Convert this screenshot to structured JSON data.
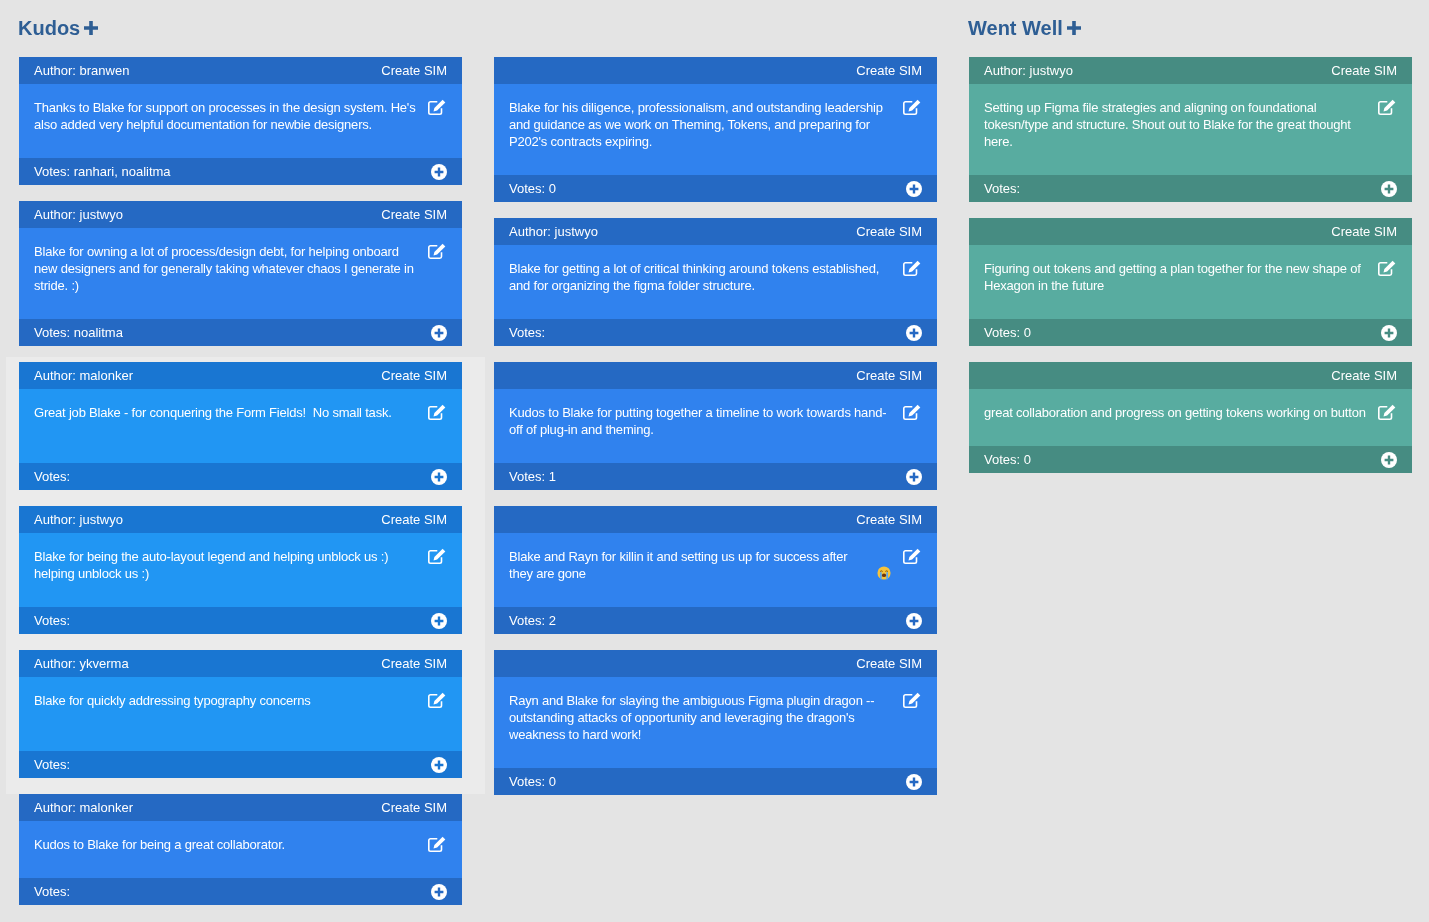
{
  "sections": [
    {
      "title": "Kudos",
      "color": "#2569c3",
      "lanes": [
        {
          "cards": [
            {
              "author": "Author: branwen",
              "action": "Create SIM",
              "text": "Thanks to Blake for support on processes in the design system. He's also added very helpful documentation for newbie designers.",
              "votes": "Votes: ranhari, noalitma",
              "highlighted": false
            },
            {
              "author": "Author: justwyo",
              "action": "Create SIM",
              "text": "Blake for owning a lot of process/design debt, for helping onboard new designers and for generally taking whatever chaos I generate in stride. :)",
              "votes": "Votes: noalitma",
              "highlighted": false
            },
            {
              "author": "Author: malonker",
              "action": "Create SIM",
              "text": "Great job Blake - for conquering the Form Fields!  No small task.",
              "votes": "Votes:",
              "highlighted": true
            },
            {
              "author": "Author: justwyo",
              "action": "Create SIM",
              "text": "Blake for being the auto-layout legend and helping unblock us :)\nhelping unblock us :)",
              "votes": "Votes:",
              "highlighted": true
            },
            {
              "author": "Author: ykverma",
              "action": "Create SIM",
              "text": "Blake for quickly addressing typography concerns",
              "votes": "Votes:",
              "highlighted": true
            },
            {
              "author": "Author: malonker",
              "action": "Create SIM",
              "text": "Kudos to Blake for being a great collaborator.",
              "votes": "Votes:",
              "highlighted": false
            }
          ]
        },
        {
          "cards": [
            {
              "action": "Create SIM",
              "text": "Blake for his diligence, professionalism, and outstanding leadership and guidance as we work on Theming, Tokens, and preparing for P202's contracts expiring.",
              "votes": "Votes: 0",
              "highlighted": false
            },
            {
              "author": "Author: justwyo",
              "action": "Create SIM",
              "text": "Blake for getting a lot of critical thinking around tokens established, and for organizing the figma folder structure.",
              "votes": "Votes:",
              "highlighted": false
            },
            {
              "action": "Create SIM",
              "text": "Kudos to Blake for putting together a timeline to work towards hand-off of plug-in and theming.",
              "votes": "Votes: 1",
              "highlighted": false
            },
            {
              "action": "Create SIM",
              "text": "Blake and Rayn for killin it and setting us up for success after they are gone",
              "reaction_icon": true,
              "votes": "Votes: 2",
              "highlighted": false
            },
            {
              "action": "Create SIM",
              "text": "Rayn and Blake for slaying the ambiguous Figma plugin dragon -- outstanding attacks of opportunity and leveraging the dragon's weakness to hard work!",
              "votes": "Votes: 0",
              "highlighted": false
            }
          ]
        }
      ]
    },
    {
      "title": "Went Well",
      "color": "#468c82",
      "lanes": [
        {
          "cards": [
            {
              "author": "Author: justwyo",
              "action": "Create SIM",
              "text": "Setting up Figma file strategies and aligning on foundational tokesn/type and structure. Shout out to Blake for the great thought here.",
              "votes": "Votes:",
              "highlighted": false
            },
            {
              "action": "Create SIM",
              "text": "Figuring out tokens and getting a plan together for the new shape of Hexagon in the future",
              "votes": "Votes: 0",
              "highlighted": false
            },
            {
              "action": "Create SIM",
              "text": "great collaboration and progress on getting tokens working on button",
              "votes": "Votes: 0",
              "highlighted": false
            }
          ]
        }
      ]
    }
  ]
}
